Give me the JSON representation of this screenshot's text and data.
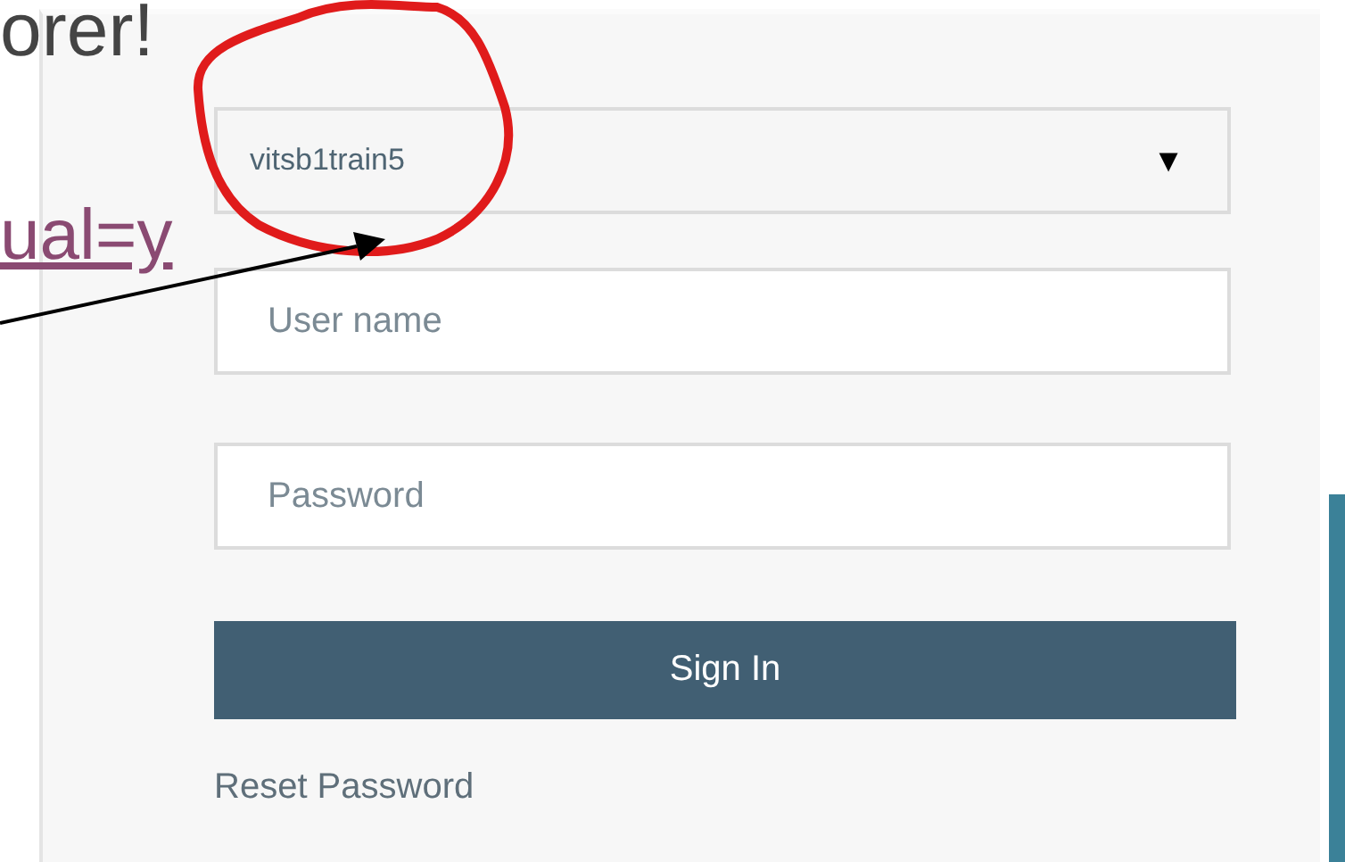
{
  "heading": "orer!",
  "link": "ual=y",
  "form": {
    "account_select": {
      "value": "vitsb1train5",
      "caret": "▼"
    },
    "username": {
      "placeholder": "User name"
    },
    "password": {
      "placeholder": "Password"
    },
    "submit": "Sign In",
    "reset_link": "Reset Password"
  },
  "annotations": [
    {
      "kind": "circle"
    },
    {
      "kind": "arrow"
    }
  ]
}
